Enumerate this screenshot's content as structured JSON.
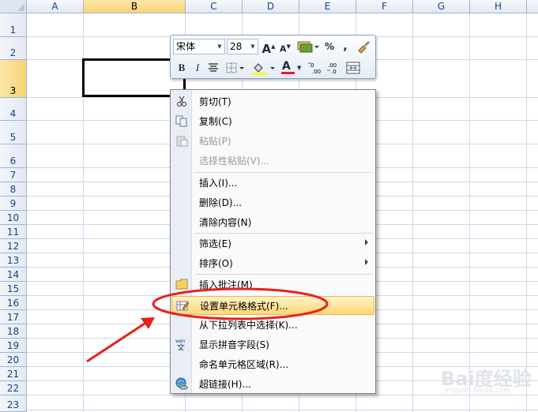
{
  "columns": [
    "A",
    "B",
    "C",
    "D",
    "E",
    "F",
    "G",
    "H"
  ],
  "rows": [
    "1",
    "2",
    "3",
    "4",
    "5",
    "6",
    "7",
    "8",
    "9",
    "10",
    "11",
    "12",
    "13",
    "14",
    "15",
    "16",
    "17",
    "18",
    "19",
    "20",
    "21",
    "22",
    "23"
  ],
  "mini_toolbar": {
    "font_name": "宋体",
    "font_size": "28",
    "percent_label": "%",
    "comma_label": ",",
    "bold_label": "B",
    "italic_label": "I",
    "font_color_label": "A",
    "grow_label": "A",
    "shrink_label": "A"
  },
  "context_menu": {
    "items": [
      {
        "label": "剪切(T)",
        "icon": "scissors-icon",
        "enabled": true
      },
      {
        "label": "复制(C)",
        "icon": "copy-icon",
        "enabled": true
      },
      {
        "label": "粘贴(P)",
        "icon": "paste-icon",
        "enabled": false
      },
      {
        "label": "选择性粘贴(V)...",
        "icon": "",
        "enabled": false
      },
      {
        "label": "插入(I)...",
        "icon": "",
        "enabled": true
      },
      {
        "label": "删除(D)...",
        "icon": "",
        "enabled": true
      },
      {
        "label": "清除内容(N)",
        "icon": "",
        "enabled": true
      },
      {
        "label": "筛选(E)",
        "icon": "",
        "enabled": true,
        "submenu": true
      },
      {
        "label": "排序(O)",
        "icon": "",
        "enabled": true,
        "submenu": true
      },
      {
        "label": "插入批注(M)",
        "icon": "comment-icon",
        "enabled": true
      },
      {
        "label": "设置单元格格式(F)...",
        "icon": "format-cells-icon",
        "enabled": true,
        "highlighted": true
      },
      {
        "label": "从下拉列表中选择(K)...",
        "icon": "",
        "enabled": true
      },
      {
        "label": "显示拼音字段(S)",
        "icon": "phonetic-icon",
        "enabled": true
      },
      {
        "label": "命名单元格区域(R)...",
        "icon": "",
        "enabled": true
      },
      {
        "label": "超链接(H)...",
        "icon": "hyperlink-icon",
        "enabled": true
      }
    ]
  },
  "annotation": {
    "ellipse_color": "#e8201c",
    "arrow_color": "#e8201c"
  },
  "watermark": {
    "main": "Bai度经验",
    "sub": "jingyan.baidu.com"
  },
  "colors": {
    "header_selected": "#f9d477",
    "grid": "#d0d7e5",
    "header_text": "#15428b"
  }
}
